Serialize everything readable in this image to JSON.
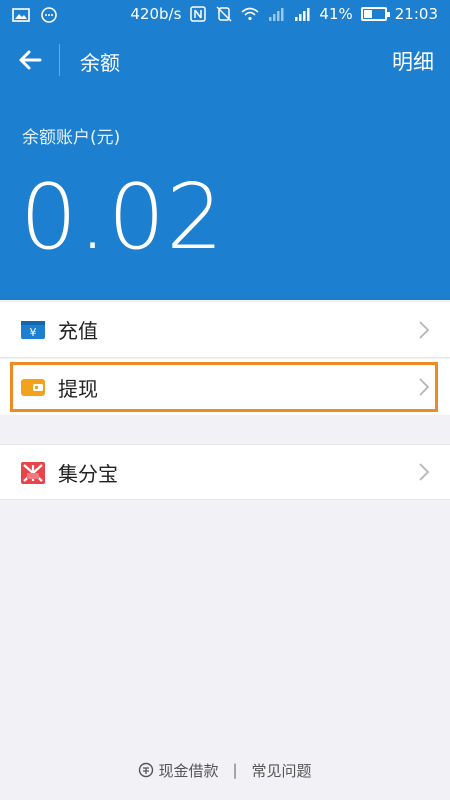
{
  "status_bar": {
    "speed": "420b/s",
    "battery_pct": "41%",
    "battery_level": 0.41,
    "time": "21:03",
    "icons": [
      "gallery-icon",
      "message-icon",
      "nfc-icon",
      "mute-icon",
      "wifi-icon",
      "signal-icon",
      "signal-icon",
      "battery-icon"
    ]
  },
  "header": {
    "title": "余额",
    "detail_label": "明细",
    "balance_label": "余额账户(元)",
    "balance_amount": "0.02",
    "background_color": "#1d7fd0"
  },
  "menu": {
    "items": [
      {
        "label": "充值",
        "icon": "recharge-card-icon"
      },
      {
        "label": "提现",
        "icon": "wallet-icon"
      },
      {
        "label": "集分宝",
        "icon": "jifenbao-icon"
      }
    ]
  },
  "highlight": {
    "color": "#f08a24"
  },
  "footer": {
    "loan_label": "现金借款",
    "separator": "|",
    "faq_label": "常见问题"
  }
}
